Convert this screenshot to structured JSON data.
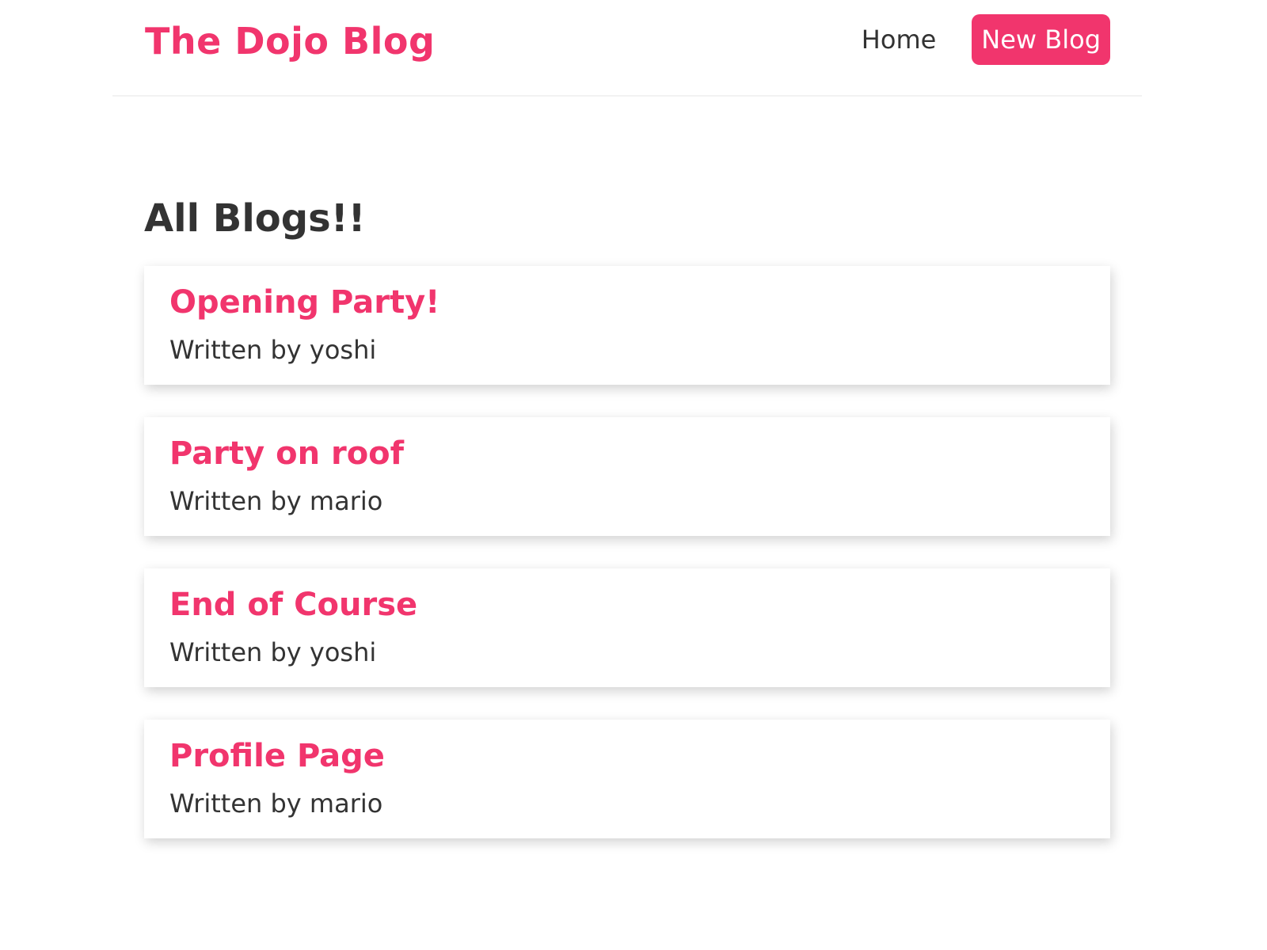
{
  "navbar": {
    "brand": "The Dojo Blog",
    "links": {
      "home": "Home",
      "new_blog": "New Blog"
    }
  },
  "main": {
    "title": "All Blogs!!",
    "blogs": [
      {
        "title": "Opening Party!",
        "author": "Written by yoshi"
      },
      {
        "title": "Party on roof",
        "author": "Written by mario"
      },
      {
        "title": "End of Course",
        "author": "Written by yoshi"
      },
      {
        "title": "Profile Page",
        "author": "Written by mario"
      }
    ]
  },
  "colors": {
    "accent": "#f1356d",
    "text": "#333333",
    "background": "#ffffff"
  }
}
